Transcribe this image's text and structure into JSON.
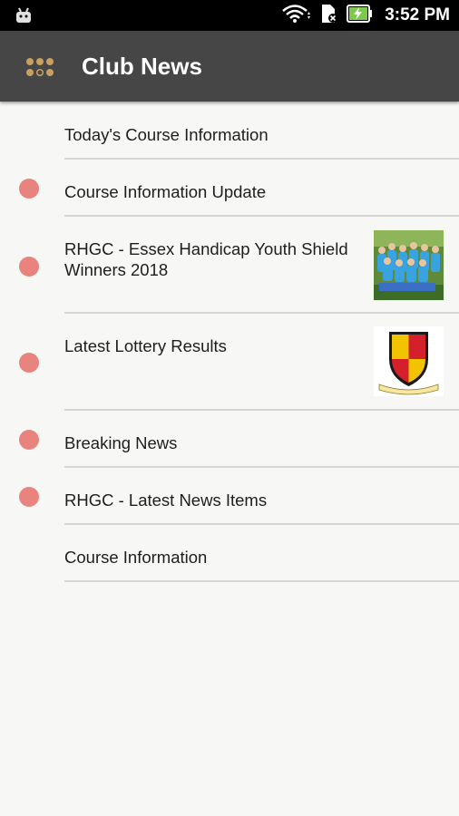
{
  "status_bar": {
    "time": "3:52 PM"
  },
  "app_bar": {
    "title": "Club News",
    "menu_icon": "grid-dots-icon",
    "accent": "#c8a060"
  },
  "news_items": [
    {
      "label": "Today's Course Information",
      "unread": false,
      "thumbnail": null
    },
    {
      "label": "Course Information Update",
      "unread": true,
      "thumbnail": null
    },
    {
      "label": "RHGC - Essex Handicap Youth Shield Winners 2018",
      "unread": true,
      "thumbnail": "team-photo"
    },
    {
      "label": "Latest Lottery Results",
      "unread": true,
      "thumbnail": "club-crest"
    },
    {
      "label": "Breaking News",
      "unread": true,
      "thumbnail": null
    },
    {
      "label": "RHGC - Latest News Items",
      "unread": true,
      "thumbnail": null
    },
    {
      "label": "Course Information",
      "unread": false,
      "thumbnail": null
    }
  ],
  "colors": {
    "unread_dot": "#e8837d",
    "app_bar": "#464646",
    "background": "#f7f7f6"
  }
}
